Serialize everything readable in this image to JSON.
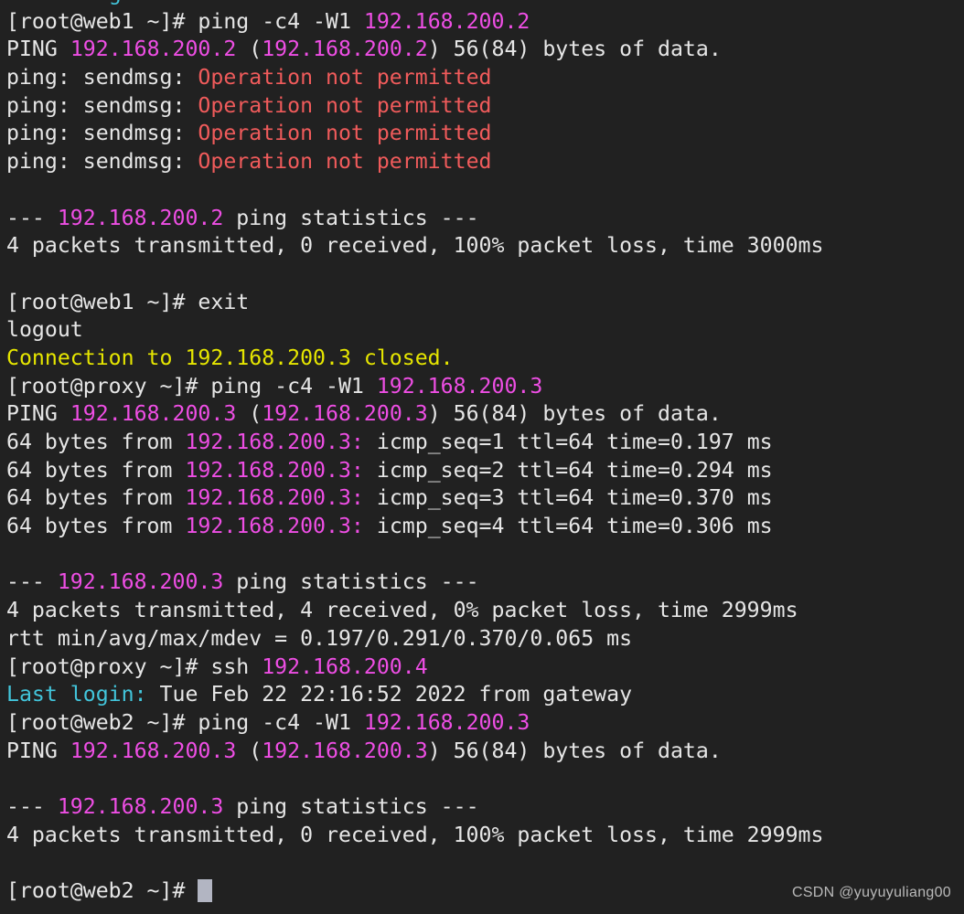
{
  "terminal": {
    "background_color": "#212121",
    "default_text_color": "#e6e6e6",
    "palette": {
      "white": "#e6e6e6",
      "red": "#f05b5b",
      "magenta": "#ee4ee4",
      "yellow": "#e6e600",
      "cyan": "#42c5db",
      "green": "#3fd33f"
    },
    "cursor": {
      "name": "block-cursor",
      "color": "#b2b5c2"
    },
    "lines": [
      {
        "id": "line-00-partial-scrollback",
        "segments": [
          {
            "text": "        ",
            "color": "white"
          },
          {
            "text": "g",
            "color": "cyan"
          }
        ]
      },
      {
        "id": "line-01-prompt-ping-web1",
        "segments": [
          {
            "text": "[root@web1 ~]# ping -c4 -W1 ",
            "color": "white"
          },
          {
            "text": "192.168.200.2",
            "color": "magenta"
          }
        ]
      },
      {
        "id": "line-02-ping-header",
        "segments": [
          {
            "text": "PING ",
            "color": "white"
          },
          {
            "text": "192.168.200.2",
            "color": "magenta"
          },
          {
            "text": " (",
            "color": "white"
          },
          {
            "text": "192.168.200.2",
            "color": "magenta"
          },
          {
            "text": ") 56(84) bytes of data.",
            "color": "white"
          }
        ]
      },
      {
        "id": "line-03-sendmsg-1",
        "segments": [
          {
            "text": "ping: sendmsg: ",
            "color": "white"
          },
          {
            "text": "Operation not permitted",
            "color": "red"
          }
        ]
      },
      {
        "id": "line-04-sendmsg-2",
        "segments": [
          {
            "text": "ping: sendmsg: ",
            "color": "white"
          },
          {
            "text": "Operation not permitted",
            "color": "red"
          }
        ]
      },
      {
        "id": "line-05-sendmsg-3",
        "segments": [
          {
            "text": "ping: sendmsg: ",
            "color": "white"
          },
          {
            "text": "Operation not permitted",
            "color": "red"
          }
        ]
      },
      {
        "id": "line-06-sendmsg-4",
        "segments": [
          {
            "text": "ping: sendmsg: ",
            "color": "white"
          },
          {
            "text": "Operation not permitted",
            "color": "red"
          }
        ]
      },
      {
        "id": "line-07-blank",
        "segments": [
          {
            "text": "",
            "color": "white"
          }
        ]
      },
      {
        "id": "line-08-stats-header-200-2",
        "segments": [
          {
            "text": "--- ",
            "color": "white"
          },
          {
            "text": "192.168.200.2",
            "color": "magenta"
          },
          {
            "text": " ping statistics ---",
            "color": "white"
          }
        ]
      },
      {
        "id": "line-09-stats-200-2",
        "segments": [
          {
            "text": "4 packets transmitted, 0 received, 100% packet loss, time 3000ms",
            "color": "white"
          }
        ]
      },
      {
        "id": "line-10-blank",
        "segments": [
          {
            "text": "",
            "color": "white"
          }
        ]
      },
      {
        "id": "line-11-prompt-exit",
        "segments": [
          {
            "text": "[root@web1 ~]# exit",
            "color": "white"
          }
        ]
      },
      {
        "id": "line-12-logout",
        "segments": [
          {
            "text": "logout",
            "color": "white"
          }
        ]
      },
      {
        "id": "line-13-connection-closed",
        "segments": [
          {
            "text": "Connection to 192.168.200.3 closed.",
            "color": "yellow"
          }
        ]
      },
      {
        "id": "line-14-prompt-ping-proxy",
        "segments": [
          {
            "text": "[root@proxy ~]# ping -c4 -W1 ",
            "color": "white"
          },
          {
            "text": "192.168.200.3",
            "color": "magenta"
          }
        ]
      },
      {
        "id": "line-15-ping-header-200-3",
        "segments": [
          {
            "text": "PING ",
            "color": "white"
          },
          {
            "text": "192.168.200.3",
            "color": "magenta"
          },
          {
            "text": " (",
            "color": "white"
          },
          {
            "text": "192.168.200.3",
            "color": "magenta"
          },
          {
            "text": ") 56(84) bytes of data.",
            "color": "white"
          }
        ]
      },
      {
        "id": "line-16-reply-1",
        "segments": [
          {
            "text": "64 bytes from ",
            "color": "white"
          },
          {
            "text": "192.168.200.3:",
            "color": "magenta"
          },
          {
            "text": " icmp_seq=1 ttl=64 time=0.197 ms",
            "color": "white"
          }
        ]
      },
      {
        "id": "line-17-reply-2",
        "segments": [
          {
            "text": "64 bytes from ",
            "color": "white"
          },
          {
            "text": "192.168.200.3:",
            "color": "magenta"
          },
          {
            "text": " icmp_seq=2 ttl=64 time=0.294 ms",
            "color": "white"
          }
        ]
      },
      {
        "id": "line-18-reply-3",
        "segments": [
          {
            "text": "64 bytes from ",
            "color": "white"
          },
          {
            "text": "192.168.200.3:",
            "color": "magenta"
          },
          {
            "text": " icmp_seq=3 ttl=64 time=0.370 ms",
            "color": "white"
          }
        ]
      },
      {
        "id": "line-19-reply-4",
        "segments": [
          {
            "text": "64 bytes from ",
            "color": "white"
          },
          {
            "text": "192.168.200.3:",
            "color": "magenta"
          },
          {
            "text": " icmp_seq=4 ttl=64 time=0.306 ms",
            "color": "white"
          }
        ]
      },
      {
        "id": "line-20-blank",
        "segments": [
          {
            "text": "",
            "color": "white"
          }
        ]
      },
      {
        "id": "line-21-stats-header-200-3-ok",
        "segments": [
          {
            "text": "--- ",
            "color": "white"
          },
          {
            "text": "192.168.200.3",
            "color": "magenta"
          },
          {
            "text": " ping statistics ---",
            "color": "white"
          }
        ]
      },
      {
        "id": "line-22-stats-200-3-ok",
        "segments": [
          {
            "text": "4 packets transmitted, 4 received, 0% packet loss, time 2999ms",
            "color": "white"
          }
        ]
      },
      {
        "id": "line-23-rtt",
        "segments": [
          {
            "text": "rtt min/avg/max/mdev = 0.197/0.291/0.370/0.065 ms",
            "color": "white"
          }
        ]
      },
      {
        "id": "line-24-prompt-ssh",
        "segments": [
          {
            "text": "[root@proxy ~]# ssh ",
            "color": "white"
          },
          {
            "text": "192.168.200.4",
            "color": "magenta"
          }
        ]
      },
      {
        "id": "line-25-last-login",
        "segments": [
          {
            "text": "Last login:",
            "color": "cyan"
          },
          {
            "text": " Tue Feb 22 22:16:52 2022 from gateway",
            "color": "white"
          }
        ]
      },
      {
        "id": "line-26-prompt-ping-web2",
        "segments": [
          {
            "text": "[root@web2 ~]# ping -c4 -W1 ",
            "color": "white"
          },
          {
            "text": "192.168.200.3",
            "color": "magenta"
          }
        ]
      },
      {
        "id": "line-27-ping-header-web2",
        "segments": [
          {
            "text": "PING ",
            "color": "white"
          },
          {
            "text": "192.168.200.3",
            "color": "magenta"
          },
          {
            "text": " (",
            "color": "white"
          },
          {
            "text": "192.168.200.3",
            "color": "magenta"
          },
          {
            "text": ") 56(84) bytes of data.",
            "color": "white"
          }
        ]
      },
      {
        "id": "line-28-blank",
        "segments": [
          {
            "text": "",
            "color": "white"
          }
        ]
      },
      {
        "id": "line-29-stats-header-web2",
        "segments": [
          {
            "text": "--- ",
            "color": "white"
          },
          {
            "text": "192.168.200.3",
            "color": "magenta"
          },
          {
            "text": " ping statistics ---",
            "color": "white"
          }
        ]
      },
      {
        "id": "line-30-stats-web2",
        "segments": [
          {
            "text": "4 packets transmitted, 0 received, 100% packet loss, time 2999ms",
            "color": "white"
          }
        ]
      },
      {
        "id": "line-31-blank",
        "segments": [
          {
            "text": "",
            "color": "white"
          }
        ]
      },
      {
        "id": "line-32-final-prompt",
        "segments": [
          {
            "text": "[root@web2 ~]# ",
            "color": "white"
          }
        ],
        "cursor": true
      }
    ]
  },
  "watermark": {
    "text": "CSDN @yuyuyuliang00",
    "color": "#b9b9b9"
  }
}
